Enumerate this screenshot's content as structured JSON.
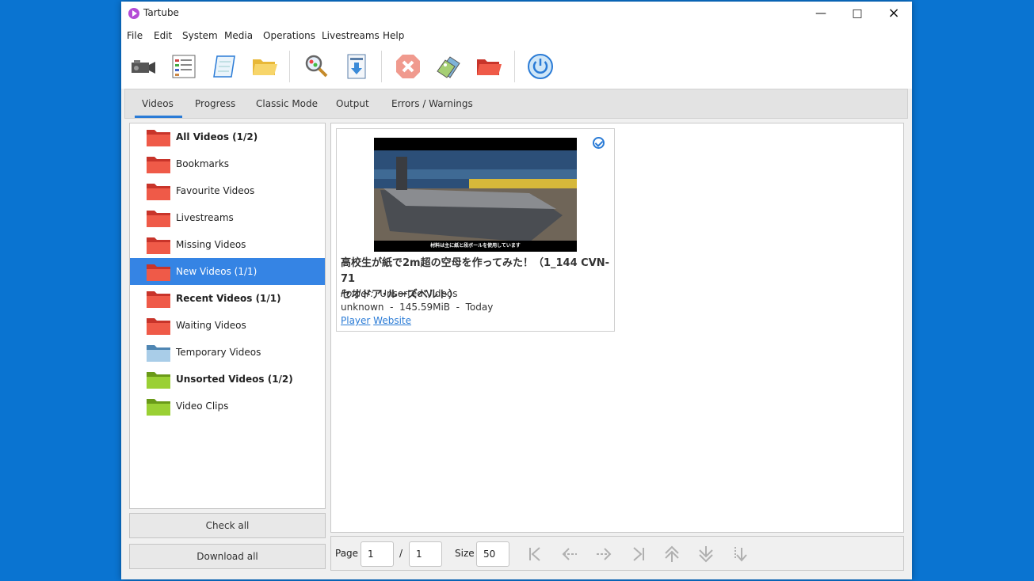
{
  "window": {
    "title": "Tartube"
  },
  "menu": [
    "File",
    "Edit",
    "System",
    "Media",
    "Operations",
    "Livestreams",
    "Help"
  ],
  "toolbar": {
    "icons": [
      "video-camera-icon",
      "checklist-icon",
      "scroll-icon",
      "folder-open-icon",
      "search-magnifier-icon",
      "download-arrow-icon",
      "stop-icon",
      "tags-icon",
      "red-folder-icon",
      "power-icon"
    ]
  },
  "tabs": [
    "Videos",
    "Progress",
    "Classic Mode",
    "Output",
    "Errors / Warnings"
  ],
  "folders": [
    {
      "label": "All Videos (1/2)",
      "bold": true,
      "color": "red"
    },
    {
      "label": "Bookmarks",
      "bold": false,
      "color": "red"
    },
    {
      "label": "Favourite Videos",
      "bold": false,
      "color": "red"
    },
    {
      "label": "Livestreams",
      "bold": false,
      "color": "red"
    },
    {
      "label": "Missing Videos",
      "bold": false,
      "color": "red"
    },
    {
      "label": "New Videos (1/1)",
      "bold": false,
      "color": "red",
      "selected": true
    },
    {
      "label": "Recent Videos (1/1)",
      "bold": true,
      "color": "red"
    },
    {
      "label": "Waiting Videos",
      "bold": false,
      "color": "red"
    },
    {
      "label": "Temporary Videos",
      "bold": false,
      "color": "blue"
    },
    {
      "label": "Unsorted Videos (1/2)",
      "bold": true,
      "color": "green"
    },
    {
      "label": "Video Clips",
      "bold": false,
      "color": "green"
    }
  ],
  "buttons": {
    "check_all": "Check all",
    "download_all": "Download all"
  },
  "video": {
    "title_line1": "高校生が紙で2m超の空母を作ってみた！（1_144 CVN-71",
    "title_line2": "セオドア･ルーズベルト）",
    "folder_label": "Folder:",
    "folder_value": "Unsorted Videos",
    "meta": "unknown  -  145.59MiB  -  Today",
    "link_player": "Player",
    "link_website": "Website",
    "thumb_caption": "材料は主に紙と段ボールを使用しています"
  },
  "pager": {
    "page_label": "Page",
    "page_value": "1",
    "sep": "/",
    "page_total": "1",
    "size_label": "Size",
    "size_value": "50"
  },
  "colors": {
    "accent": "#3584e4",
    "folder_red": "#e8483a",
    "folder_blue": "#7fb3d9",
    "folder_green": "#8ec62a",
    "desktop": "#0a74d1"
  }
}
